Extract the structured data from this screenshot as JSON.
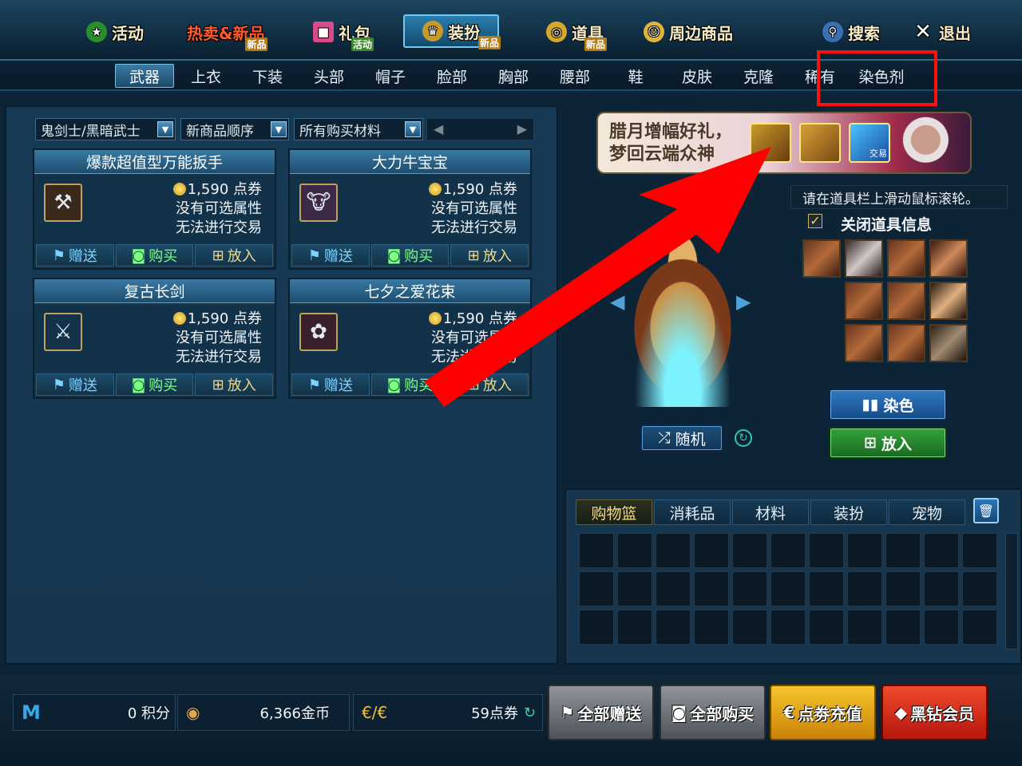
{
  "topnav": [
    {
      "label": "活动",
      "icon": "star-badge-icon",
      "badge": ""
    },
    {
      "label": "热卖&新品",
      "icon": "",
      "badge": "新品"
    },
    {
      "label": "礼包",
      "icon": "gift-box-icon",
      "badge": "活动"
    },
    {
      "label": "装扮",
      "icon": "trophy-icon",
      "badge": "新品"
    },
    {
      "label": "道具",
      "icon": "coin-icon",
      "badge": "新品"
    },
    {
      "label": "周边商品",
      "icon": "smiley-icon",
      "badge": ""
    },
    {
      "label": "搜索",
      "icon": "search-icon",
      "badge": ""
    },
    {
      "label": "退出",
      "icon": "close-icon",
      "badge": ""
    }
  ],
  "categories": [
    "武器",
    "上衣",
    "下装",
    "头部",
    "帽子",
    "脸部",
    "胸部",
    "腰部",
    "鞋",
    "皮肤",
    "克隆",
    "稀有",
    "染色剂"
  ],
  "filters": {
    "character": "鬼剑士/黑暗武士",
    "sort": "新商品顺序",
    "material": "所有购买材料"
  },
  "pager": {
    "prev": "◀",
    "next": "▶"
  },
  "items": [
    {
      "name": "爆款超值型万能扳手",
      "price": "1,590 点券",
      "line2": "没有可选属性",
      "line3": "无法进行交易",
      "icon": "wrench-axe-icon"
    },
    {
      "name": "大力牛宝宝",
      "price": "1,590 点券",
      "line2": "没有可选属性",
      "line3": "无法进行交易",
      "icon": "bull-doll-icon"
    },
    {
      "name": "复古长剑",
      "price": "1,590 点券",
      "line2": "没有可选属性",
      "line3": "无法进行交易",
      "icon": "long-sword-icon"
    },
    {
      "name": "七夕之爱花束",
      "price": "1,590 点券",
      "line2": "没有可选属性",
      "line3": "无法进行交易",
      "icon": "flower-bouquet-icon"
    }
  ],
  "item_actions": {
    "gift": "赠送",
    "buy": "购买",
    "put": "放入"
  },
  "banner": {
    "line1": "腊月增幅好礼，",
    "line2": "梦回云端众神",
    "tag": "交易"
  },
  "preview": {
    "tip": "请在道具栏上滑动鼠标滚轮。",
    "close_info": "关闭道具信息",
    "random": "随机",
    "dye": "染色",
    "put": "放入"
  },
  "basket": {
    "tabs": [
      "购物篮",
      "消耗品",
      "材料",
      "装扮",
      "宠物"
    ]
  },
  "bottom": {
    "points": "0 积分",
    "gold": "6,366金币",
    "coupons": "59点券",
    "gift_all": "全部赠送",
    "buy_all": "全部购买",
    "recharge": "点劵充值",
    "vip": "黑钻会员"
  },
  "colors": {
    "accent_blue": "#2f7ac1",
    "buy_green": "#7dff84",
    "highlight_red": "#ff1010",
    "recharge_gold": "#f6c62d",
    "vip_red": "#ef4a2d"
  }
}
